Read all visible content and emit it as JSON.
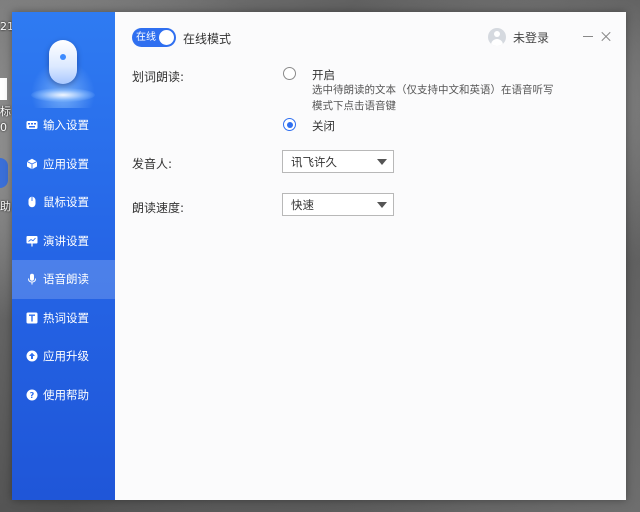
{
  "desktop": {
    "fragments": [
      "21",
      "标",
      "0",
      "助"
    ]
  },
  "sidebar": {
    "items": [
      {
        "label": "输入设置",
        "icon": "keyboard-icon",
        "active": false
      },
      {
        "label": "应用设置",
        "icon": "cube-icon",
        "active": false
      },
      {
        "label": "鼠标设置",
        "icon": "mouse-icon",
        "active": false
      },
      {
        "label": "演讲设置",
        "icon": "presentation-icon",
        "active": false
      },
      {
        "label": "语音朗读",
        "icon": "microphone-icon",
        "active": true
      },
      {
        "label": "热词设置",
        "icon": "text-icon",
        "active": false
      },
      {
        "label": "应用升级",
        "icon": "upgrade-icon",
        "active": false
      },
      {
        "label": "使用帮助",
        "icon": "help-icon",
        "active": false
      }
    ]
  },
  "header": {
    "toggle_label": "在线",
    "toggle_on": true,
    "mode_label": "在线模式",
    "user_label": "未登录"
  },
  "form": {
    "read_label": "划词朗读:",
    "option_on": "开启",
    "option_on_desc": "选中待朗读的文本（仅支持中文和英语）在语音听写模式下点击语音键",
    "option_off": "关闭",
    "selected_option": "关闭",
    "speaker_label": "发音人:",
    "speaker_value": "讯飞许久",
    "speed_label": "朗读速度:",
    "speed_value": "快速"
  },
  "colors": {
    "accent": "#2f6ff0",
    "sidebar_top": "#2f7bf2",
    "sidebar_bottom": "#1f56d8"
  }
}
